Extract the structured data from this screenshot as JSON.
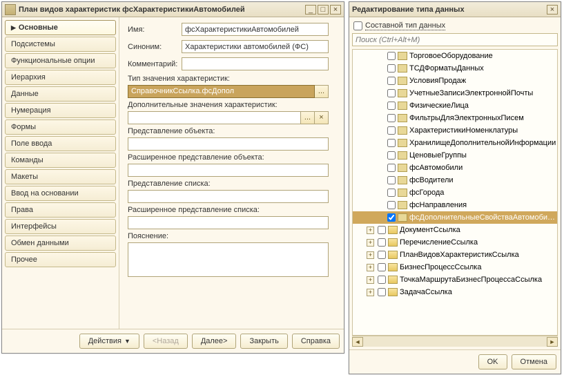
{
  "left_window": {
    "title": "План видов характеристик фсХарактеристикиАвтомобилей",
    "sidebar": [
      {
        "label": "Основные",
        "active": true
      },
      {
        "label": "Подсистемы"
      },
      {
        "label": "Функциональные опции"
      },
      {
        "label": "Иерархия"
      },
      {
        "label": "Данные"
      },
      {
        "label": "Нумерация"
      },
      {
        "label": "Формы"
      },
      {
        "label": "Поле ввода"
      },
      {
        "label": "Команды"
      },
      {
        "label": "Макеты"
      },
      {
        "label": "Ввод на основании"
      },
      {
        "label": "Права"
      },
      {
        "label": "Интерфейсы"
      },
      {
        "label": "Обмен данными"
      },
      {
        "label": "Прочее"
      }
    ],
    "form": {
      "name_label": "Имя:",
      "name_value": "фсХарактеристикиАвтомобилей",
      "synonym_label": "Синоним:",
      "synonym_value": "Характеристики автомобилей (ФС)",
      "comment_label": "Комментарий:",
      "comment_value": "",
      "type_label": "Тип значения характеристик:",
      "type_value": "СправочникСсылка.фсДопол",
      "type_btn": "...",
      "addvals_label": "Дополнительные значения характеристик:",
      "addvals_value": "",
      "addvals_btn1": "...",
      "addvals_btn2": "×",
      "obj_repr_label": "Представление объекта:",
      "obj_repr_value": "",
      "ext_obj_repr_label": "Расширенное представление объекта:",
      "ext_obj_repr_value": "",
      "list_repr_label": "Представление списка:",
      "list_repr_value": "",
      "ext_list_repr_label": "Расширенное представление списка:",
      "ext_list_repr_value": "",
      "explain_label": "Пояснение:",
      "explain_value": ""
    },
    "footer": {
      "actions": "Действия",
      "back": "<Назад",
      "next": "Далее>",
      "close": "Закрыть",
      "help": "Справка"
    }
  },
  "right_window": {
    "title": "Редактирование типа данных",
    "compound_label": "Составной тип данных",
    "compound_checked": false,
    "search_placeholder": "Поиск (Ctrl+Alt+M)",
    "tree": [
      {
        "kind": "ref",
        "label": "ТорговоеОборудование",
        "checked": false
      },
      {
        "kind": "ref",
        "label": "ТСДФорматыДанных",
        "checked": false
      },
      {
        "kind": "ref",
        "label": "УсловияПродаж",
        "checked": false
      },
      {
        "kind": "ref",
        "label": "УчетныеЗаписиЭлектроннойПочты",
        "checked": false
      },
      {
        "kind": "ref",
        "label": "ФизическиеЛица",
        "checked": false
      },
      {
        "kind": "ref",
        "label": "ФильтрыДляЭлектронныхПисем",
        "checked": false
      },
      {
        "kind": "ref",
        "label": "ХарактеристикиНоменклатуры",
        "checked": false
      },
      {
        "kind": "ref",
        "label": "ХранилищеДополнительнойИнформации",
        "checked": false
      },
      {
        "kind": "ref",
        "label": "ЦеновыеГруппы",
        "checked": false
      },
      {
        "kind": "ref",
        "label": "фсАвтомобили",
        "checked": false
      },
      {
        "kind": "ref",
        "label": "фсВодители",
        "checked": false
      },
      {
        "kind": "ref",
        "label": "фсГорода",
        "checked": false
      },
      {
        "kind": "ref",
        "label": "фсНаправления",
        "checked": false
      },
      {
        "kind": "ref",
        "label": "фсДополнительныеСвойстваАвтомобилей",
        "checked": true,
        "selected": true
      },
      {
        "kind": "group",
        "label": "ДокументСсылка"
      },
      {
        "kind": "group",
        "label": "ПеречислениеСсылка"
      },
      {
        "kind": "group",
        "label": "ПланВидовХарактеристикСсылка"
      },
      {
        "kind": "group",
        "label": "БизнесПроцессСсылка"
      },
      {
        "kind": "group",
        "label": "ТочкаМаршрутаБизнесПроцессаСсылка"
      },
      {
        "kind": "group",
        "label": "ЗадачаСсылка"
      }
    ],
    "footer": {
      "ok": "OK",
      "cancel": "Отмена"
    }
  }
}
